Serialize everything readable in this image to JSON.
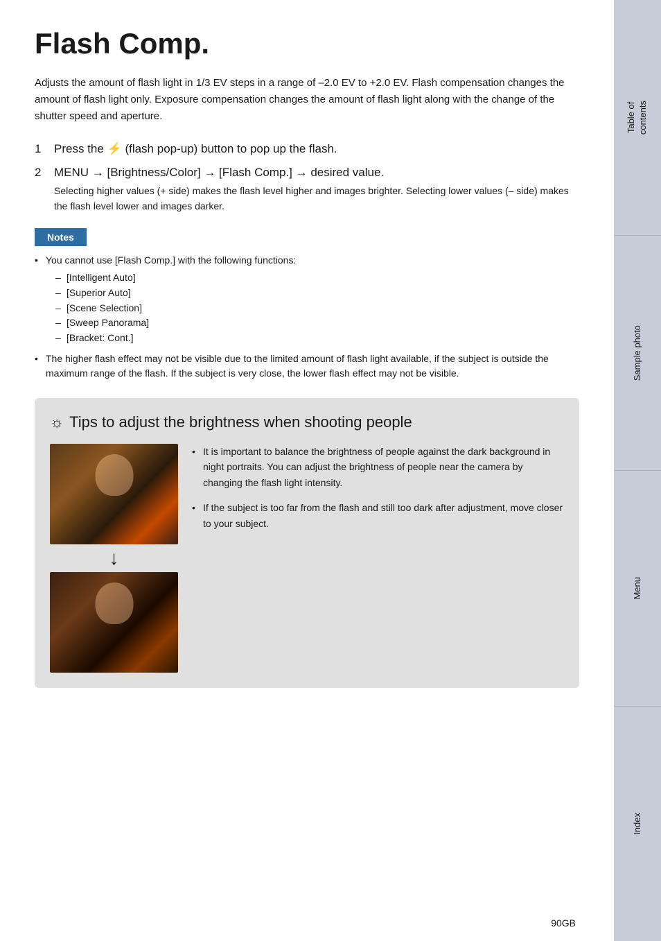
{
  "page": {
    "title": "Flash Comp.",
    "intro": "Adjusts the amount of flash light in 1/3 EV steps in a range of –2.0 EV to +2.0 EV. Flash compensation changes the amount of flash light only. Exposure compensation changes the amount of flash light along with the change of the shutter speed and aperture.",
    "steps": [
      {
        "number": "1",
        "text": "Press the ⚡ (flash pop-up) button to pop up the flash."
      },
      {
        "number": "2",
        "title": "MENU → [Brightness/Color] → [Flash Comp.] → desired value.",
        "detail": "Selecting higher values (+ side) makes the flash level higher and images brighter. Selecting lower values (– side) makes the flash level lower and images darker."
      }
    ],
    "notes_label": "Notes",
    "notes": [
      {
        "text": "You cannot use [Flash Comp.] with the following functions:",
        "subitems": [
          "[Intelligent Auto]",
          "[Superior Auto]",
          "[Scene Selection]",
          "[Sweep Panorama]",
          "[Bracket: Cont.]"
        ]
      },
      {
        "text": "The higher flash effect may not be visible due to the limited amount of flash light available, if the subject is outside the maximum range of the flash. If the subject is very close, the lower flash effect may not be visible.",
        "subitems": []
      }
    ],
    "tips": {
      "title": "Tips to adjust the brightness when shooting people",
      "icon": "☼",
      "items": [
        "It is important to balance the brightness of people against the dark background in night portraits. You can adjust the brightness of people near the camera by changing the flash light intensity.",
        "If the subject is too far from the flash and still too dark after adjustment, move closer to your subject."
      ]
    },
    "page_number": "90GB"
  },
  "sidebar": {
    "tabs": [
      {
        "label": "Table of\ncontents"
      },
      {
        "label": "Sample photo"
      },
      {
        "label": "Menu"
      },
      {
        "label": "Index"
      }
    ]
  }
}
